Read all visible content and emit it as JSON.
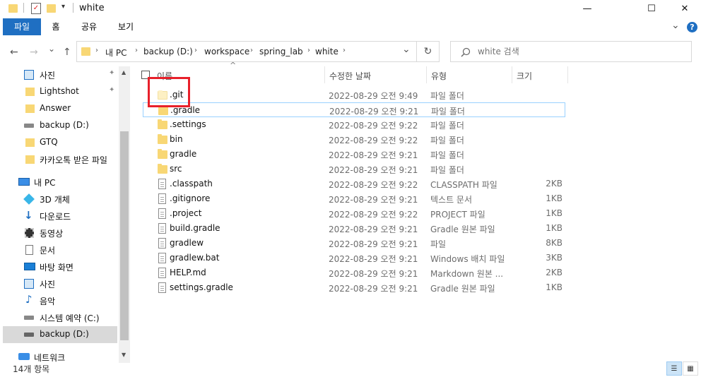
{
  "window": {
    "title": "white",
    "minimize_glyph": "—",
    "maximize_glyph": "☐",
    "close_glyph": "✕"
  },
  "ribbon": {
    "tabs": [
      {
        "label": "파일",
        "active": true
      },
      {
        "label": "홈",
        "active": false
      },
      {
        "label": "공유",
        "active": false
      },
      {
        "label": "보기",
        "active": false
      }
    ],
    "expand_glyph": "⌄",
    "help_glyph": "?"
  },
  "address": {
    "back_glyph": "←",
    "forward_glyph": "→",
    "recent_glyph": "⌄",
    "up_glyph": "↑",
    "breadcrumbs": [
      "내 PC",
      "backup (D:)",
      "workspace",
      "spring_lab",
      "white"
    ],
    "dropdown_glyph": "⌄",
    "refresh_glyph": "↻"
  },
  "search": {
    "placeholder": "white 검색",
    "icon": "search-icon"
  },
  "sidebar": {
    "items": [
      {
        "label": "사진",
        "icon": "pictures-icon",
        "pinned": true
      },
      {
        "label": "Lightshot",
        "icon": "folder-icon",
        "pinned": true
      },
      {
        "label": "Answer",
        "icon": "folder-icon",
        "pinned": false
      },
      {
        "label": "backup (D:)",
        "icon": "drive-icon",
        "pinned": false
      },
      {
        "label": "GTQ",
        "icon": "folder-icon",
        "pinned": false
      },
      {
        "label": "카카오톡 받은 파일",
        "icon": "folder-icon",
        "pinned": false
      },
      {
        "label": "내 PC",
        "icon": "pc-icon",
        "pinned": false
      },
      {
        "label": "3D 개체",
        "icon": "3d-objects-icon",
        "pinned": false
      },
      {
        "label": "다운로드",
        "icon": "download-icon",
        "pinned": false
      },
      {
        "label": "동영상",
        "icon": "video-icon",
        "pinned": false
      },
      {
        "label": "문서",
        "icon": "document-icon",
        "pinned": false
      },
      {
        "label": "바탕 화면",
        "icon": "desktop-icon",
        "pinned": false
      },
      {
        "label": "사진",
        "icon": "pictures-icon",
        "pinned": false
      },
      {
        "label": "음악",
        "icon": "music-icon",
        "pinned": false
      },
      {
        "label": "시스템 예약 (C:)",
        "icon": "drive-icon",
        "pinned": false
      },
      {
        "label": "backup (D:)",
        "icon": "drive-icon",
        "pinned": false,
        "selected": true
      },
      {
        "label": "네트워크",
        "icon": "network-icon",
        "pinned": false
      }
    ],
    "pin_glyph": "📌",
    "scroll_up_glyph": "▲",
    "scroll_down_glyph": "▼"
  },
  "columns": {
    "name": "이름",
    "date": "수정한 날짜",
    "type": "유형",
    "size": "크기",
    "sort_glyph": "^"
  },
  "files": [
    {
      "name": ".git",
      "date": "2022-08-29 오전 9:49",
      "type": "파일 폴더",
      "size": "",
      "kind": "folder-hidden"
    },
    {
      "name": ".gradle",
      "date": "2022-08-29 오전 9:21",
      "type": "파일 폴더",
      "size": "",
      "kind": "folder"
    },
    {
      "name": ".settings",
      "date": "2022-08-29 오전 9:22",
      "type": "파일 폴더",
      "size": "",
      "kind": "folder"
    },
    {
      "name": "bin",
      "date": "2022-08-29 오전 9:22",
      "type": "파일 폴더",
      "size": "",
      "kind": "folder"
    },
    {
      "name": "gradle",
      "date": "2022-08-29 오전 9:21",
      "type": "파일 폴더",
      "size": "",
      "kind": "folder"
    },
    {
      "name": "src",
      "date": "2022-08-29 오전 9:21",
      "type": "파일 폴더",
      "size": "",
      "kind": "folder"
    },
    {
      "name": ".classpath",
      "date": "2022-08-29 오전 9:22",
      "type": "CLASSPATH 파일",
      "size": "2KB",
      "kind": "file"
    },
    {
      "name": ".gitignore",
      "date": "2022-08-29 오전 9:21",
      "type": "텍스트 문서",
      "size": "1KB",
      "kind": "file"
    },
    {
      "name": ".project",
      "date": "2022-08-29 오전 9:22",
      "type": "PROJECT 파일",
      "size": "1KB",
      "kind": "file"
    },
    {
      "name": "build.gradle",
      "date": "2022-08-29 오전 9:21",
      "type": "Gradle 원본 파일",
      "size": "1KB",
      "kind": "file"
    },
    {
      "name": "gradlew",
      "date": "2022-08-29 오전 9:21",
      "type": "파일",
      "size": "8KB",
      "kind": "file"
    },
    {
      "name": "gradlew.bat",
      "date": "2022-08-29 오전 9:21",
      "type": "Windows 배치 파일",
      "size": "3KB",
      "kind": "file"
    },
    {
      "name": "HELP.md",
      "date": "2022-08-29 오전 9:21",
      "type": "Markdown 원본 ...",
      "size": "2KB",
      "kind": "file"
    },
    {
      "name": "settings.gradle",
      "date": "2022-08-29 오전 9:21",
      "type": "Gradle 원본 파일",
      "size": "1KB",
      "kind": "file"
    }
  ],
  "status": {
    "item_count": "14개 항목"
  },
  "colors": {
    "accent": "#1f6fc2",
    "highlight": "#e8202a",
    "folder": "#f8d775"
  }
}
